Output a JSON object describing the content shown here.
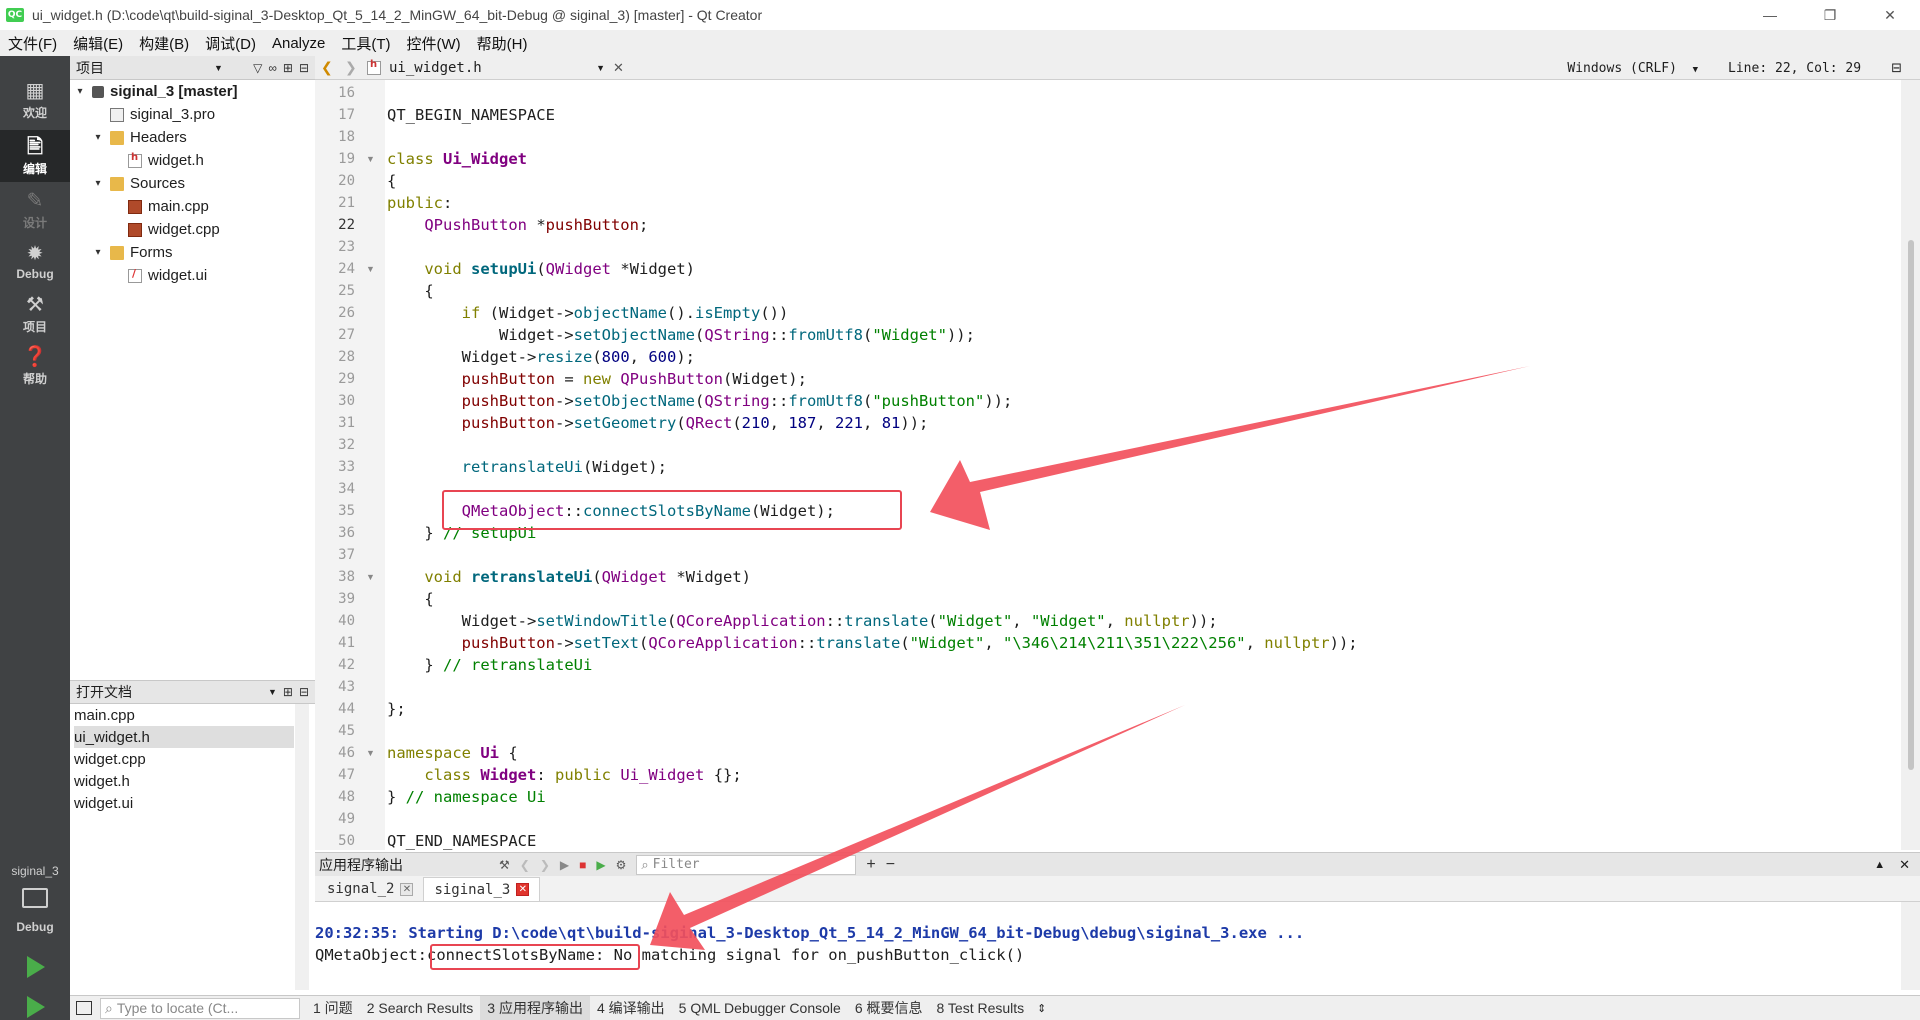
{
  "window": {
    "title": "ui_widget.h (D:\\code\\qt\\build-siginal_3-Desktop_Qt_5_14_2_MinGW_64_bit-Debug @ siginal_3) [master] - Qt Creator",
    "app_icon": "QC"
  },
  "menu": [
    "文件(F)",
    "编辑(E)",
    "构建(B)",
    "调试(D)",
    "Analyze",
    "工具(T)",
    "控件(W)",
    "帮助(H)"
  ],
  "modes": [
    {
      "label": "欢迎",
      "icon": "grid-icon"
    },
    {
      "label": "编辑",
      "icon": "edit-icon"
    },
    {
      "label": "设计",
      "icon": "pencil-icon"
    },
    {
      "label": "Debug",
      "icon": "bug-icon"
    },
    {
      "label": "项目",
      "icon": "wrench-icon"
    },
    {
      "label": "帮助",
      "icon": "help-icon"
    }
  ],
  "kit": {
    "project": "siginal_3",
    "mode": "Debug"
  },
  "project_pane": {
    "title": "项目",
    "tree": [
      {
        "label": "siginal_3 [master]",
        "type": "projroot"
      },
      {
        "label": "siginal_3.pro",
        "type": "proj"
      },
      {
        "label": "Headers",
        "type": "folder"
      },
      {
        "label": "widget.h",
        "type": "header"
      },
      {
        "label": "Sources",
        "type": "folder"
      },
      {
        "label": "main.cpp",
        "type": "cpp"
      },
      {
        "label": "widget.cpp",
        "type": "cpp"
      },
      {
        "label": "Forms",
        "type": "folder"
      },
      {
        "label": "widget.ui",
        "type": "ui"
      }
    ]
  },
  "open_docs": {
    "title": "打开文档",
    "items": [
      "main.cpp",
      "ui_widget.h",
      "widget.cpp",
      "widget.h",
      "widget.ui"
    ],
    "selected": 1
  },
  "editor": {
    "file": "ui_widget.h",
    "line_ending": "Windows (CRLF)",
    "position": "Line: 22, Col: 29",
    "current_line": 22,
    "lines": [
      {
        "n": "16",
        "html": ""
      },
      {
        "n": "17",
        "html": "QT_BEGIN_NAMESPACE"
      },
      {
        "n": "18",
        "html": ""
      },
      {
        "n": "19",
        "fold": true,
        "html": "<span class=\"kw\">class</span> <span class=\"cls\">Ui_Widget</span>"
      },
      {
        "n": "20",
        "html": "{"
      },
      {
        "n": "21",
        "html": "<span class=\"kw\">public</span>:"
      },
      {
        "n": "22",
        "html": "    <span class=\"ty\">QPushButton</span> *<span class=\"mem\">pushButton</span>;"
      },
      {
        "n": "23",
        "html": ""
      },
      {
        "n": "24",
        "fold": true,
        "html": "    <span class=\"kw\">void</span> <span class=\"fnb\">setupUi</span>(<span class=\"ty\">QWidget</span> *Widget)"
      },
      {
        "n": "25",
        "html": "    {"
      },
      {
        "n": "26",
        "html": "        <span class=\"kw\">if</span> (Widget-&gt;<span class=\"fn\">objectName</span>().<span class=\"fn\">isEmpty</span>())"
      },
      {
        "n": "27",
        "html": "            Widget-&gt;<span class=\"fn\">setObjectName</span>(<span class=\"ty\">QString</span>::<span class=\"fn\">fromUtf8</span>(<span class=\"str\">\"Widget\"</span>));"
      },
      {
        "n": "28",
        "html": "        Widget-&gt;<span class=\"fn\">resize</span>(<span class=\"nm\">800</span>, <span class=\"nm\">600</span>);"
      },
      {
        "n": "29",
        "html": "        <span class=\"mem\">pushButton</span> = <span class=\"kw\">new</span> <span class=\"ty\">QPushButton</span>(Widget);"
      },
      {
        "n": "30",
        "html": "        <span class=\"mem\">pushButton</span>-&gt;<span class=\"fn\">setObjectName</span>(<span class=\"ty\">QString</span>::<span class=\"fn\">fromUtf8</span>(<span class=\"str\">\"pushButton\"</span>));"
      },
      {
        "n": "31",
        "html": "        <span class=\"mem\">pushButton</span>-&gt;<span class=\"fn\">setGeometry</span>(<span class=\"ty\">QRect</span>(<span class=\"nm\">210</span>, <span class=\"nm\">187</span>, <span class=\"nm\">221</span>, <span class=\"nm\">81</span>));"
      },
      {
        "n": "32",
        "html": ""
      },
      {
        "n": "33",
        "html": "        <span class=\"fn\">retranslateUi</span>(Widget);"
      },
      {
        "n": "34",
        "html": ""
      },
      {
        "n": "35",
        "html": "        <span class=\"ty\">QMetaObject</span>::<span class=\"fn\">connectSlotsByName</span>(Widget);"
      },
      {
        "n": "36",
        "html": "    } <span class=\"cm\">// setupUi</span>"
      },
      {
        "n": "37",
        "html": ""
      },
      {
        "n": "38",
        "fold": true,
        "html": "    <span class=\"kw\">void</span> <span class=\"fnb\">retranslateUi</span>(<span class=\"ty\">QWidget</span> *Widget)"
      },
      {
        "n": "39",
        "html": "    {"
      },
      {
        "n": "40",
        "html": "        Widget-&gt;<span class=\"fn\">setWindowTitle</span>(<span class=\"ty\">QCoreApplication</span>::<span class=\"fn\">translate</span>(<span class=\"str\">\"Widget\"</span>, <span class=\"str\">\"Widget\"</span>, <span class=\"kw\">nullptr</span>));"
      },
      {
        "n": "41",
        "html": "        <span class=\"mem\">pushButton</span>-&gt;<span class=\"fn\">setText</span>(<span class=\"ty\">QCoreApplication</span>::<span class=\"fn\">translate</span>(<span class=\"str\">\"Widget\"</span>, <span class=\"str\">\"\\346\\214\\211\\351\\222\\256\"</span>, <span class=\"kw\">nullptr</span>));"
      },
      {
        "n": "42",
        "html": "    } <span class=\"cm\">// retranslateUi</span>"
      },
      {
        "n": "43",
        "html": ""
      },
      {
        "n": "44",
        "html": "};"
      },
      {
        "n": "45",
        "html": ""
      },
      {
        "n": "46",
        "fold": true,
        "html": "<span class=\"kw\">namespace</span> <span class=\"cls\">Ui</span> {"
      },
      {
        "n": "47",
        "html": "    <span class=\"kw\">class</span> <span class=\"cls\">Widget</span>: <span class=\"kw\">public</span> <span class=\"ty\">Ui_Widget</span> {};"
      },
      {
        "n": "48",
        "html": "} <span class=\"cm\">// namespace Ui</span>"
      },
      {
        "n": "49",
        "html": ""
      },
      {
        "n": "50",
        "html": "QT_END_NAMESPACE"
      }
    ]
  },
  "output": {
    "title": "应用程序输出",
    "filter_placeholder": "Filter",
    "tabs": [
      {
        "label": "signal_2",
        "active": false
      },
      {
        "label": "siginal_3",
        "active": true
      }
    ],
    "lines": [
      "20:32:35: Starting D:\\code\\qt\\build-siginal_3-Desktop_Qt_5_14_2_MinGW_64_bit-Debug\\debug\\siginal_3.exe ...",
      "QMetaObject::connectSlotsByName: No matching signal for on_pushButton_click()"
    ],
    "msg_prefix": "QMetaObject",
    "msg_highlight": ":connectSlotsByName:",
    "msg_rest": " No matching signal for on_pushButton_click()"
  },
  "statusbar": {
    "locator_placeholder": "Type to locate (Ct...",
    "tabs": [
      "1 问题",
      "2 Search Results",
      "3 应用程序输出",
      "4 编译输出",
      "5 QML Debugger Console",
      "6 概要信息",
      "8 Test Results"
    ],
    "active": 2
  },
  "colors": {
    "annotation": "#e84552",
    "run": "#4aad4a"
  }
}
